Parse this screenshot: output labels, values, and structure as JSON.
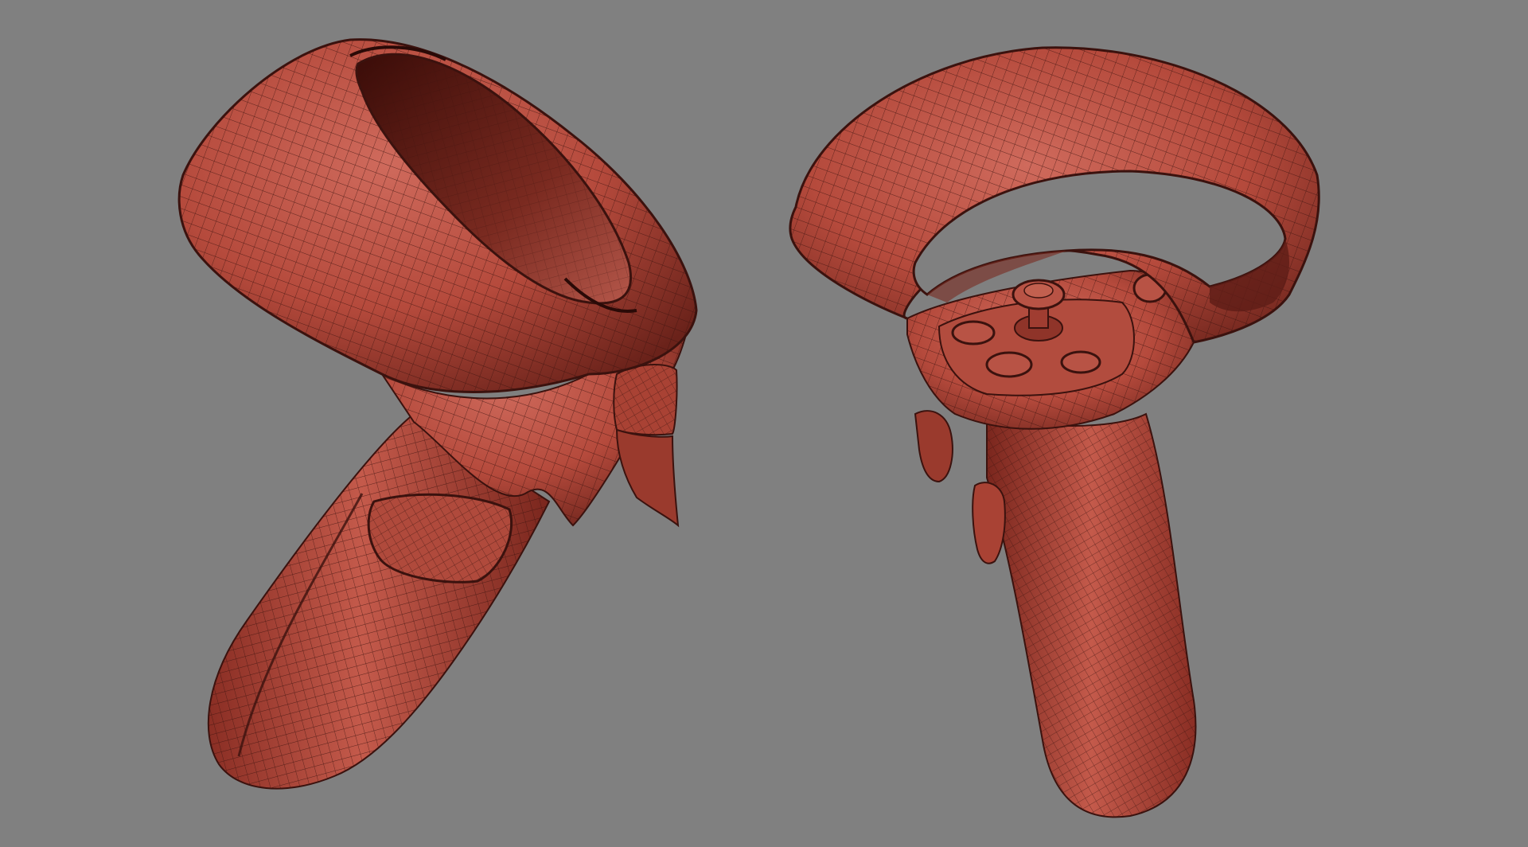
{
  "viewport": {
    "background_color": "#808080"
  },
  "models": [
    {
      "name": "left-controller",
      "base_color": "#b54a3c",
      "shadow_color": "#5a1c16",
      "highlight_color": "#cf6a5c",
      "wire_color": "#3b120e"
    },
    {
      "name": "right-controller",
      "base_color": "#b54a3c",
      "shadow_color": "#5a1c16",
      "highlight_color": "#cf6a5c",
      "wire_color": "#3b120e"
    }
  ]
}
